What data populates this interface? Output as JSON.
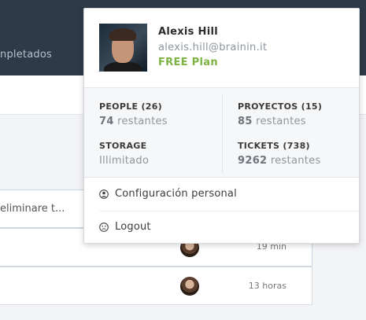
{
  "background": {
    "nav_label": "npletados",
    "input_text": "eliminare t...",
    "rows": [
      {
        "time": "19 min"
      },
      {
        "time": "13 horas"
      }
    ]
  },
  "user": {
    "name": "Alexis Hill",
    "email": "alexis.hill@brainin.it",
    "plan": "FREE Plan",
    "plan_color": "#7cb342"
  },
  "stats": {
    "people": {
      "label": "PEOPLE (26)",
      "count": "74",
      "suffix": "restantes"
    },
    "proyectos": {
      "label": "PROYECTOS (15)",
      "count": "85",
      "suffix": "restantes"
    },
    "storage": {
      "label": "STORAGE",
      "value": "Illimitado"
    },
    "tickets": {
      "label": "TICKETS (738)",
      "count": "9262",
      "suffix": "restantes"
    }
  },
  "menu": {
    "settings": {
      "label": "Configuración personal",
      "icon": "user-circle-icon"
    },
    "logout": {
      "label": "Logout",
      "icon": "sad-face-icon"
    }
  }
}
